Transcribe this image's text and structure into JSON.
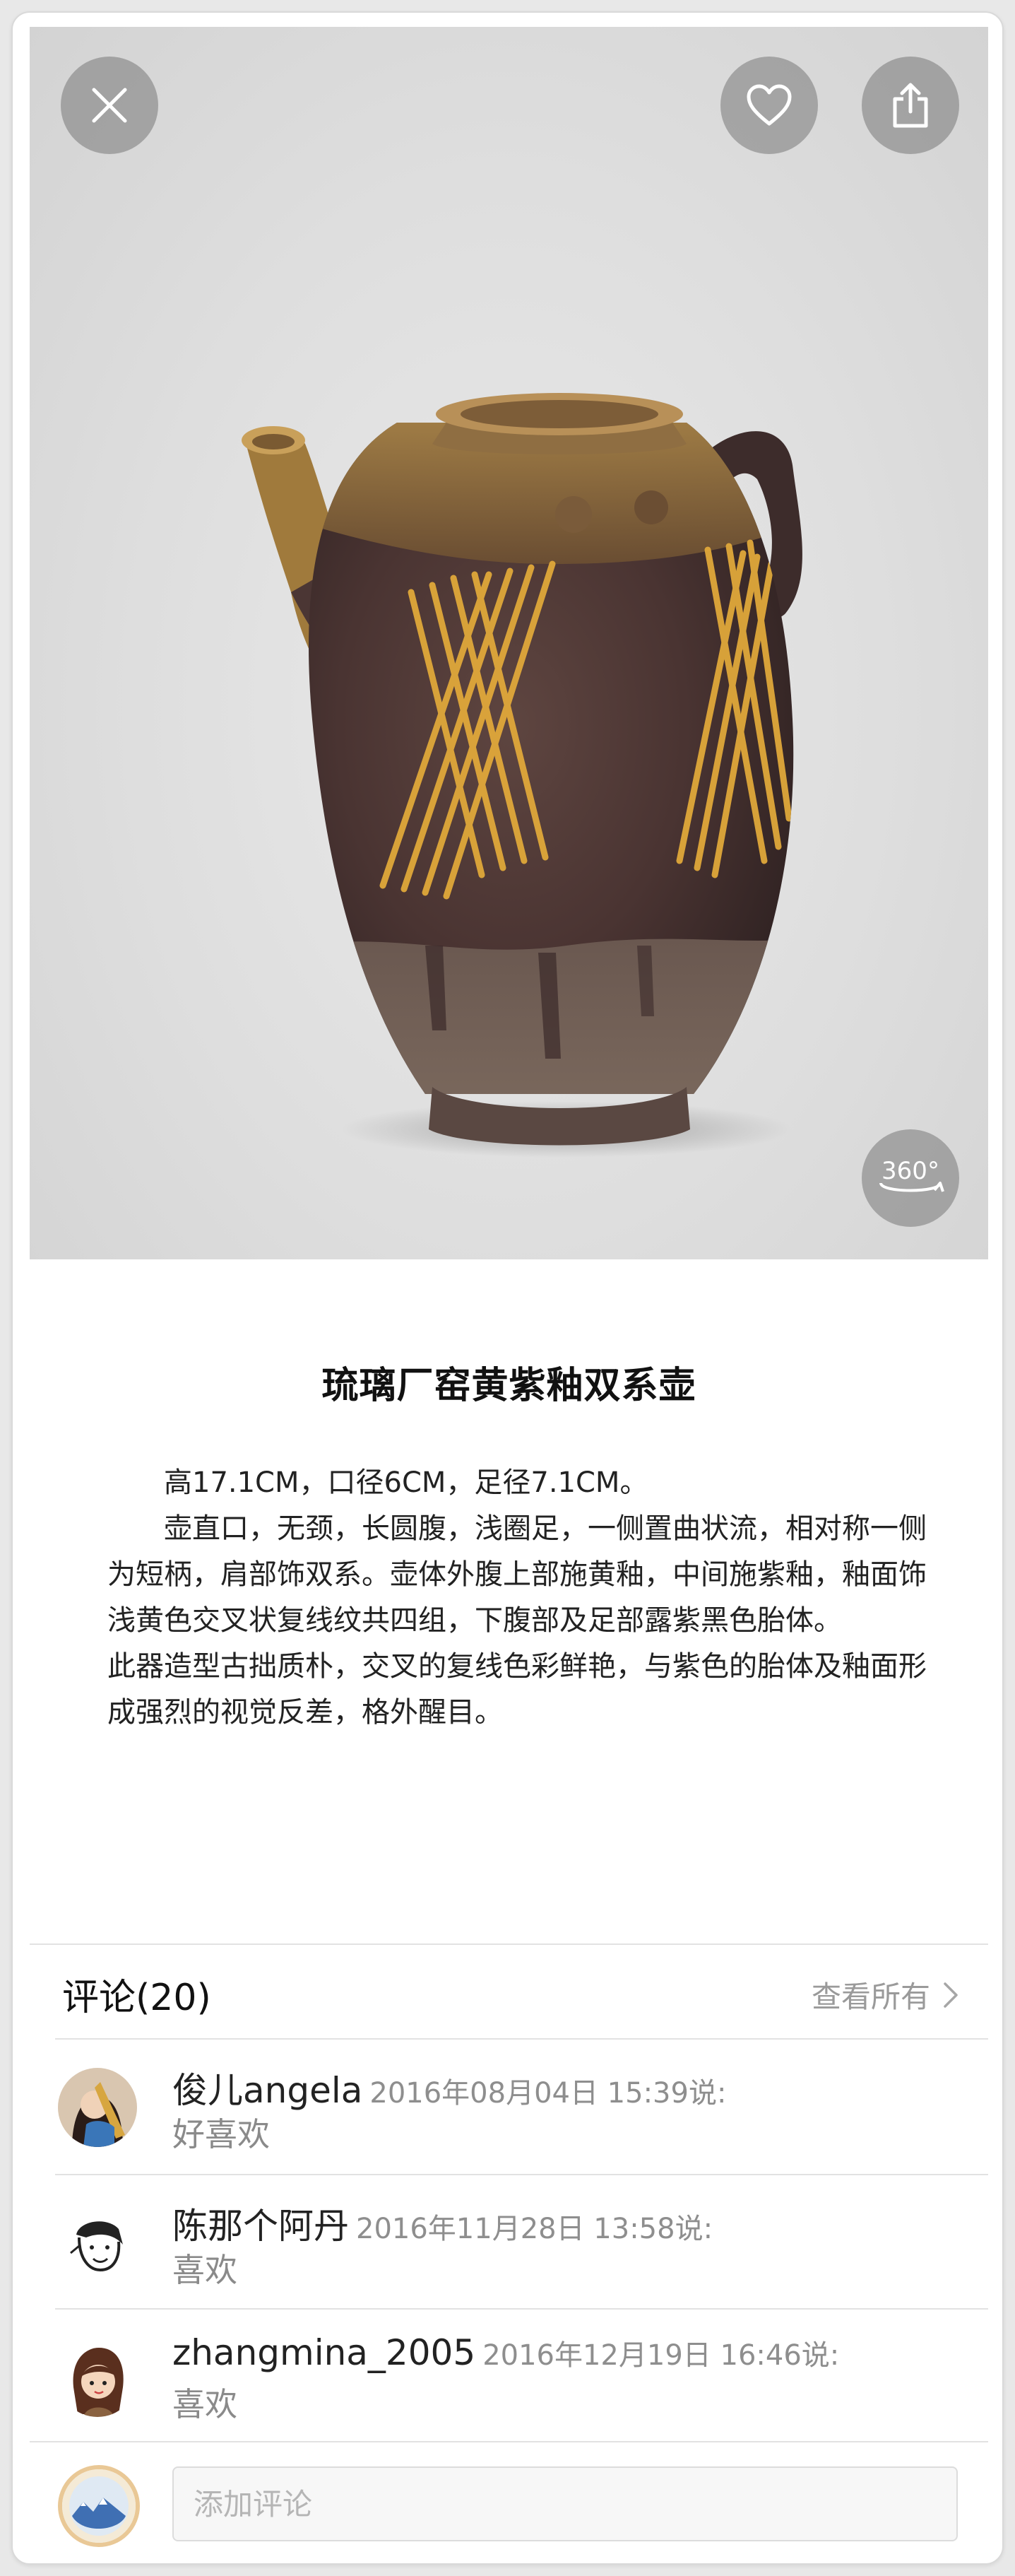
{
  "hero": {
    "icons": {
      "close": "close-icon",
      "favorite": "heart-icon",
      "share": "share-icon",
      "rotate": "360-view-icon"
    },
    "rotate_label": "360°"
  },
  "artifact": {
    "title": "琉璃厂窑黄紫釉双系壶",
    "dimensions": "高17.1CM，口径6CM，足径7.1CM。",
    "description": "壶直口，无颈，长圆腹，浅圈足，一侧置曲状流，相对称一侧为短柄，肩部饰双系。壶体外腹上部施黄釉，中间施紫釉，釉面饰浅黄色交叉状复线纹共四组，下腹部及足部露紫黑色胎体。",
    "commentary": "此器造型古拙质朴，交叉的复线色彩鲜艳，与紫色的胎体及釉面形成强烈的视觉反差，格外醒目。"
  },
  "comments": {
    "header": "评论(20)",
    "view_all": "查看所有",
    "items": [
      {
        "user": "俊儿angela",
        "meta": "2016年08月04日 15:39说:",
        "text": "好喜欢"
      },
      {
        "user": "陈那个阿丹",
        "meta": "2016年11月28日 13:58说:",
        "text": "喜欢"
      },
      {
        "user": "zhangmina_2005",
        "meta": "2016年12月19日 16:46说:",
        "text": "喜欢"
      }
    ]
  },
  "composer": {
    "placeholder": "添加评论",
    "value": ""
  },
  "colors": {
    "background": "#ffffff",
    "divider": "#e2e2e2",
    "meta_text": "#8e8e8e",
    "avatar_ring": "#e9c896"
  }
}
